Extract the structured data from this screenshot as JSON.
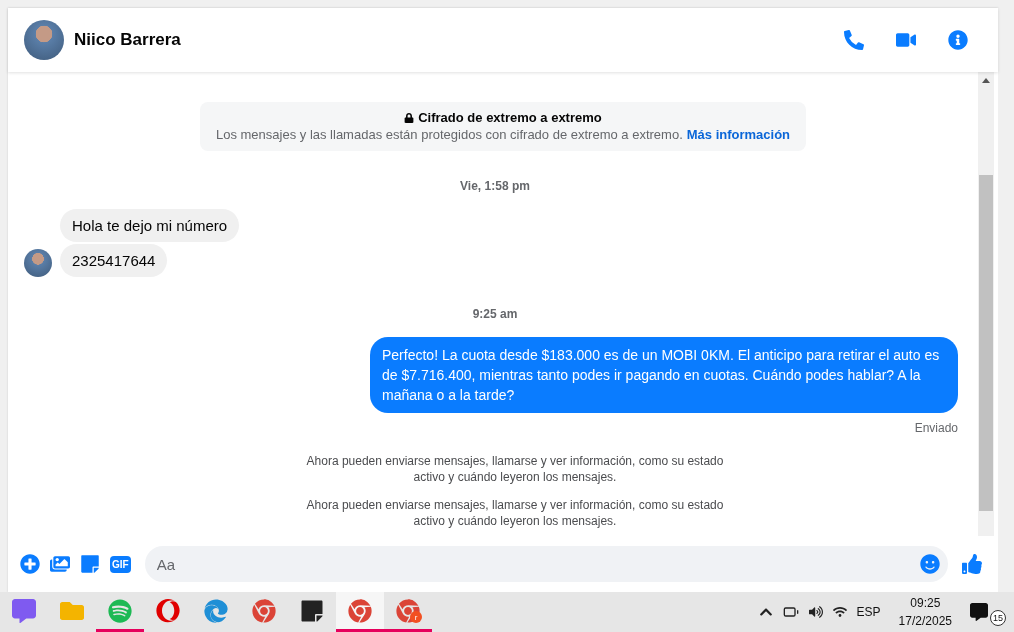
{
  "header": {
    "name": "Niico Barrera"
  },
  "encryption": {
    "title": "Cifrado de extremo a extremo",
    "text": "Los mensajes y las llamadas están protegidos con cifrado de extremo a extremo.",
    "link": "Más información"
  },
  "messages": [
    {
      "kind": "time",
      "text": "Vie, 1:58 pm"
    },
    {
      "kind": "incoming",
      "text": "Hola te dejo mi número",
      "avatar": false
    },
    {
      "kind": "incoming",
      "text": "2325417644",
      "avatar": true
    },
    {
      "kind": "time",
      "text": "9:25 am"
    },
    {
      "kind": "outgoing",
      "text": "Perfecto! La cuota desde $183.000 es de un MOBI 0KM. El anticipo para retirar el auto es de $7.716.400, mientras tanto podes ir pagando en cuotas. Cuándo podes hablar? A la mañana o a la tarde?"
    },
    {
      "kind": "status",
      "text": "Enviado"
    },
    {
      "kind": "notice",
      "text": "Ahora pueden enviarse mensajes, llamarse y ver información, como su estado activo y cuándo leyeron los mensajes."
    },
    {
      "kind": "notice",
      "text": "Ahora pueden enviarse mensajes, llamarse y ver información, como su estado activo y cuándo leyeron los mensajes."
    }
  ],
  "composer": {
    "placeholder": "Aa",
    "gif_label": "GIF"
  },
  "taskbar": {
    "apps": [
      {
        "kind": "copilot",
        "running": false
      },
      {
        "kind": "folder",
        "running": false
      },
      {
        "kind": "spotify",
        "running": true
      },
      {
        "kind": "opera",
        "running": false
      },
      {
        "kind": "edge",
        "running": false
      },
      {
        "kind": "chrome",
        "running": false
      },
      {
        "kind": "notes",
        "running": false
      },
      {
        "kind": "chrome",
        "running": true,
        "selected": true
      },
      {
        "kind": "chrome",
        "running": true,
        "selected": false,
        "badge": "r"
      }
    ],
    "language": "ESP",
    "time": "09:25",
    "date": "17/2/2025",
    "notifications": "15"
  }
}
